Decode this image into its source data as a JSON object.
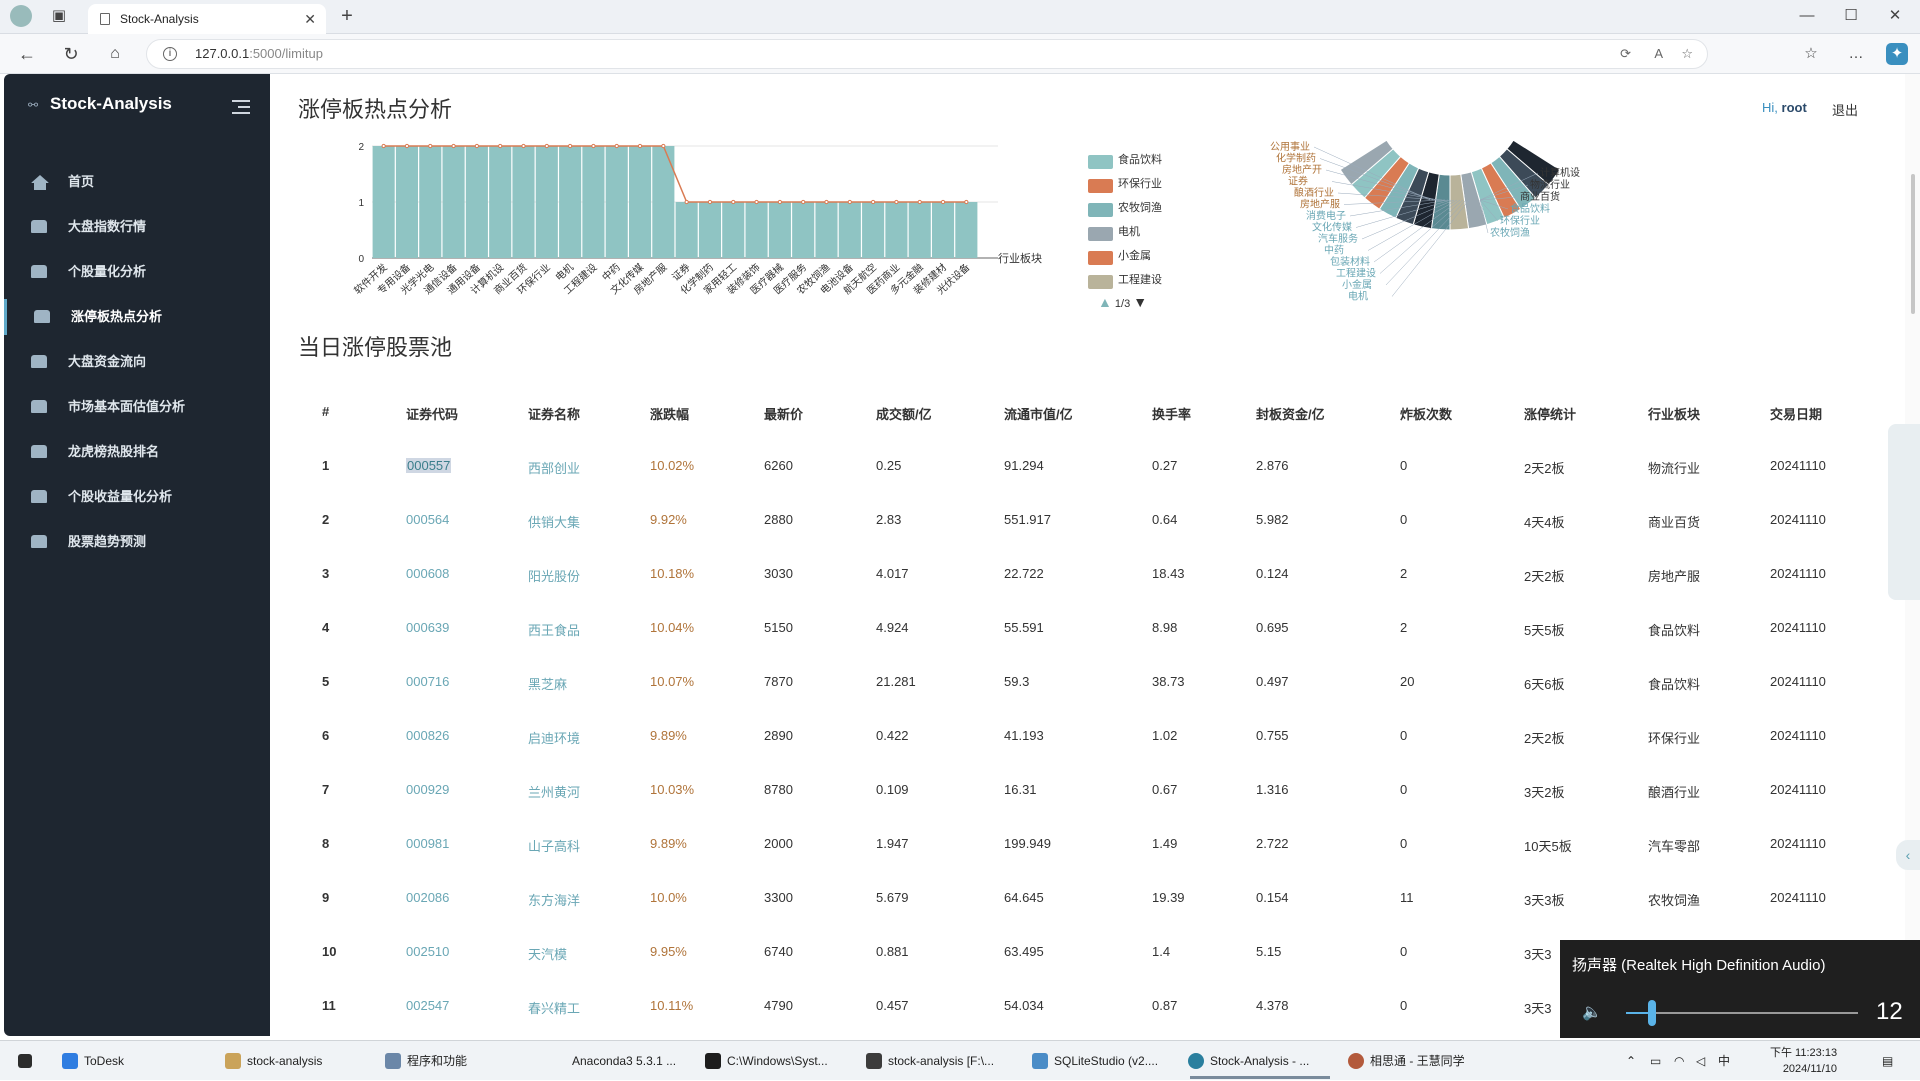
{
  "browser": {
    "tab_title": "Stock-Analysis",
    "url_host": "127.0.0.1",
    "url_rest": ":5000/limitup"
  },
  "sidebar": {
    "brand": "Stock-Analysis",
    "items": [
      {
        "label": "首页",
        "icon": "home-icon"
      },
      {
        "label": "大盘指数行情",
        "icon": "chart-icon"
      },
      {
        "label": "个股量化分析",
        "icon": "chart-icon"
      },
      {
        "label": "涨停板热点分析",
        "icon": "chart-icon"
      },
      {
        "label": "大盘资金流向",
        "icon": "chart-icon"
      },
      {
        "label": "市场基本面估值分析",
        "icon": "chart-icon"
      },
      {
        "label": "龙虎榜热股排名",
        "icon": "chart-icon"
      },
      {
        "label": "个股收益量化分析",
        "icon": "chart-icon"
      },
      {
        "label": "股票趋势预测",
        "icon": "chart-icon"
      }
    ],
    "active_index": 3
  },
  "header": {
    "page_title": "涨停板热点分析",
    "greeting": "Hi,",
    "username": "root",
    "logout": "退出"
  },
  "colors": {
    "bar": "#8fc4c3",
    "accent": "#5fa9c9",
    "sidebar_bg": "#1e2630",
    "line": "#d97b53",
    "change": "#b0743a",
    "code": "#6aa7b5"
  },
  "chart_data": [
    {
      "type": "bar",
      "x_axis_name": "行业板块",
      "ylim": [
        0,
        2
      ],
      "yticks": [
        "0",
        "1",
        "2"
      ],
      "categories": [
        "软件开发",
        "专用设备",
        "光学光电",
        "通信设备",
        "通用设备",
        "计算机设",
        "商业百货",
        "环保行业",
        "电机",
        "工程建设",
        "中药",
        "文化传媒",
        "房地产服",
        "证券",
        "化学制药",
        "家用轻工",
        "装修装饰",
        "医疗器械",
        "医疗服务",
        "农牧饲渔",
        "电池设备",
        "航天航空",
        "医药商业",
        "多元金融",
        "装修建材",
        "光伏设备"
      ],
      "values": [
        2,
        2,
        2,
        2,
        2,
        2,
        2,
        2,
        2,
        2,
        2,
        2,
        2,
        1,
        1,
        1,
        1,
        1,
        1,
        1,
        1,
        1,
        1,
        1,
        1,
        1
      ]
    },
    {
      "type": "pie",
      "legend": [
        "食品饮料",
        "环保行业",
        "农牧饲渔",
        "电机",
        "小金属",
        "工程建设"
      ],
      "legend_colors": [
        "#8fc4c3",
        "#d97b53",
        "#7fb5b8",
        "#9aa7b0",
        "#d97b53",
        "#b9b39a"
      ],
      "legend_page": "1/3",
      "labels": [
        "公用事业",
        "化学制药",
        "房地产开",
        "证券",
        "酿酒行业",
        "房地产服",
        "消费电子",
        "文化传媒",
        "汽车服务",
        "中药",
        "包装材料",
        "工程建设",
        "小金属",
        "电机",
        "计算机设",
        "物流行业",
        "商业百货",
        "食品饮料",
        "环保行业",
        "农牧饲渔"
      ]
    }
  ],
  "pool": {
    "title": "当日涨停股票池",
    "columns": [
      "#",
      "证券代码",
      "证券名称",
      "涨跌幅",
      "最新价",
      "成交额/亿",
      "流通市值/亿",
      "换手率",
      "封板资金/亿",
      "炸板次数",
      "涨停统计",
      "行业板块",
      "交易日期"
    ],
    "rows": [
      [
        "1",
        "000557",
        "西部创业",
        "10.02%",
        "6260",
        "0.25",
        "91.294",
        "0.27",
        "2.876",
        "0",
        "2天2板",
        "物流行业",
        "20241110"
      ],
      [
        "2",
        "000564",
        "供销大集",
        "9.92%",
        "2880",
        "2.83",
        "551.917",
        "0.64",
        "5.982",
        "0",
        "4天4板",
        "商业百货",
        "20241110"
      ],
      [
        "3",
        "000608",
        "阳光股份",
        "10.18%",
        "3030",
        "4.017",
        "22.722",
        "18.43",
        "0.124",
        "2",
        "2天2板",
        "房地产服",
        "20241110"
      ],
      [
        "4",
        "000639",
        "西王食品",
        "10.04%",
        "5150",
        "4.924",
        "55.591",
        "8.98",
        "0.695",
        "2",
        "5天5板",
        "食品饮料",
        "20241110"
      ],
      [
        "5",
        "000716",
        "黑芝麻",
        "10.07%",
        "7870",
        "21.281",
        "59.3",
        "38.73",
        "0.497",
        "20",
        "6天6板",
        "食品饮料",
        "20241110"
      ],
      [
        "6",
        "000826",
        "启迪环境",
        "9.89%",
        "2890",
        "0.422",
        "41.193",
        "1.02",
        "0.755",
        "0",
        "2天2板",
        "环保行业",
        "20241110"
      ],
      [
        "7",
        "000929",
        "兰州黄河",
        "10.03%",
        "8780",
        "0.109",
        "16.31",
        "0.67",
        "1.316",
        "0",
        "3天2板",
        "酿酒行业",
        "20241110"
      ],
      [
        "8",
        "000981",
        "山子高科",
        "9.89%",
        "2000",
        "1.947",
        "199.949",
        "1.49",
        "2.722",
        "0",
        "10天5板",
        "汽车零部",
        "20241110"
      ],
      [
        "9",
        "002086",
        "东方海洋",
        "10.0%",
        "3300",
        "5.679",
        "64.645",
        "19.39",
        "0.154",
        "11",
        "3天3板",
        "农牧饲渔",
        "20241110"
      ],
      [
        "10",
        "002510",
        "天汽模",
        "9.95%",
        "6740",
        "0.881",
        "63.495",
        "1.4",
        "5.15",
        "0",
        "3天3",
        "",
        ""
      ],
      [
        "11",
        "002547",
        "春兴精工",
        "10.11%",
        "4790",
        "0.457",
        "54.034",
        "0.87",
        "4.378",
        "0",
        "3天3",
        "",
        ""
      ]
    ]
  },
  "volume_flyout": {
    "device": "扬声器 (Realtek High Definition Audio)",
    "level": "12",
    "level_fraction": 0.12
  },
  "taskbar": {
    "apps": [
      "ToDesk",
      "stock-analysis",
      "程序和功能",
      "Anaconda3 5.3.1 ...",
      "C:\\Windows\\Syst...",
      "stock-analysis [F:\\...",
      "SQLiteStudio (v2....",
      "Stock-Analysis - ...",
      "相思通 - 王慧同学"
    ],
    "tray": [
      "中"
    ],
    "time": "下午 11:23:13",
    "date": "2024/11/10"
  }
}
